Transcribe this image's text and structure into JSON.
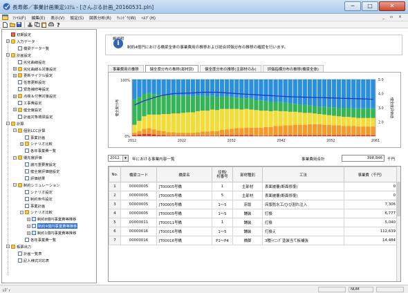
{
  "window": {
    "title": "長寿郎／事業計画策定ｼｽﾃﾑ - [さんぷる計画_20160531.pln]",
    "buttons": [
      "─",
      "□",
      "✕"
    ]
  },
  "menu": [
    "ﾌｧｲﾙ(F)",
    "編集(E)",
    "表示(V)",
    "設定(S)",
    "図表分析(R)",
    "ｳｨﾝﾄﾞｳ(W)",
    "ﾍﾙﾌﾟ(H)"
  ],
  "mdi_controls": "_ ▫ ×",
  "toolbar_icons": [
    "new-icon",
    "open-icon",
    "save-icon",
    "cut-icon",
    "copy-icon",
    "paste-icon",
    "print-icon",
    "help-icon"
  ],
  "tree": [
    {
      "label": "初期設定",
      "icon": "red",
      "expander": ""
    },
    {
      "label": "入力データ",
      "icon": "folder",
      "expander": "−"
    },
    {
      "label": "橋梁データ一覧",
      "icon": "doc",
      "expander": ""
    },
    {
      "label": "計画設定",
      "icon": "folder",
      "expander": "−"
    },
    {
      "label": "劣化曲線設定",
      "icon": "doc",
      "expander": ""
    },
    {
      "label": "劣化曲線＆対策設定",
      "icon": "folder",
      "expander": "+"
    },
    {
      "label": "更新サイクル設定",
      "icon": "folder",
      "expander": "+"
    },
    {
      "label": "任意更新設定",
      "icon": "doc",
      "expander": ""
    },
    {
      "label": "緊急補修等設定",
      "icon": "doc",
      "expander": ""
    },
    {
      "label": "点検＆付帯対策設定",
      "icon": "folder",
      "expander": "+"
    },
    {
      "label": "工事費設定",
      "icon": "doc",
      "expander": ""
    },
    {
      "label": "健全度設定",
      "icon": "folder",
      "expander": "+"
    },
    {
      "label": "計画対象橋梁設定",
      "icon": "doc",
      "expander": ""
    },
    {
      "label": "計算",
      "icon": "folder",
      "expander": "−"
    },
    {
      "label": "個別LCC計算",
      "icon": "folder",
      "expander": "−"
    },
    {
      "label": "事業計画",
      "icon": "doc",
      "expander": ""
    },
    {
      "label": "シナリオ比較",
      "icon": "folder",
      "expander": "+"
    },
    {
      "label": "各年事業費一覧",
      "icon": "doc",
      "expander": ""
    },
    {
      "label": "優先度評価",
      "icon": "folder",
      "expander": "−"
    },
    {
      "label": "諸元重要度設定",
      "icon": "doc",
      "expander": ""
    },
    {
      "label": "健全度評価値設定",
      "icon": "doc",
      "expander": ""
    },
    {
      "label": "評価結果",
      "icon": "doc",
      "expander": ""
    },
    {
      "label": "制約シミュレーション",
      "icon": "folder",
      "expander": "−"
    },
    {
      "label": "シナリオ設定",
      "icon": "doc",
      "expander": ""
    },
    {
      "label": "制約条件設定",
      "icon": "doc",
      "expander": ""
    },
    {
      "label": "事業計画",
      "icon": "doc",
      "expander": ""
    },
    {
      "label": "シナリオ比較",
      "icon": "folder",
      "expander": "−"
    },
    {
      "label": "制約8億円事業費等推移",
      "icon": "item",
      "expander": "+"
    },
    {
      "label": "制約4億円事業費等推移",
      "icon": "item",
      "expander": "+",
      "selected": true
    },
    {
      "label": "制約1億円事業費等推移",
      "icon": "item",
      "expander": "+"
    },
    {
      "label": "各年事業費一覧",
      "icon": "doc",
      "expander": ""
    },
    {
      "label": "帳票出力",
      "icon": "folder",
      "expander": "−"
    },
    {
      "label": "計画一覧表",
      "icon": "doc",
      "expander": ""
    },
    {
      "label": "記入様式対応表",
      "icon": "doc",
      "expander": ""
    }
  ],
  "explanation": {
    "title": "概説明",
    "text": "制約4億円における橋梁全体の事業費用の推移および総合評価分布の推移の確認を行います。"
  },
  "tabs": [
    "事業費用の推移",
    "健全度分布の推移(部材別)",
    "健全度分布の推移(主部材のみ)",
    "評価指標分布の推移(橋梁全体)"
  ],
  "active_tab": 1,
  "chart_data": {
    "type": "area",
    "title": "",
    "xlabel": "",
    "ylabel": "健全度分布",
    "y2label": "健全度評価値",
    "x_ticks": [
      "2012",
      "2022",
      "2032",
      "2042",
      "2052",
      "2061"
    ],
    "y_ticks": [
      "0%",
      "100%"
    ],
    "y2_ticks": [
      "2.0",
      "3.0",
      "4.0",
      "5.0"
    ],
    "xlim": [
      2012,
      2061
    ],
    "ylim": [
      0,
      100
    ],
    "y2lim": [
      1.0,
      5.0
    ],
    "stacked": true,
    "series": [
      {
        "color": "#d93b2b",
        "values": [
          2,
          3,
          4,
          4,
          3,
          2,
          2,
          1,
          1,
          1,
          1,
          1,
          1,
          1,
          1,
          1,
          1,
          1,
          2,
          2,
          2,
          2,
          2,
          2,
          2,
          1,
          1,
          1,
          1,
          2,
          2,
          2,
          2,
          2,
          2,
          2,
          2,
          2,
          2,
          2,
          2,
          2,
          2,
          2,
          2,
          2,
          2,
          2,
          2,
          2
        ]
      },
      {
        "color": "#f39a2a",
        "values": [
          4,
          6,
          9,
          10,
          9,
          8,
          7,
          6,
          6,
          5,
          5,
          5,
          5,
          6,
          7,
          7,
          8,
          8,
          9,
          10,
          11,
          12,
          12,
          13,
          13,
          14,
          14,
          15,
          15,
          16,
          16,
          17,
          17,
          18,
          18,
          18,
          19,
          19,
          19,
          18,
          18,
          17,
          17,
          16,
          16,
          16,
          15,
          15,
          15,
          15
        ]
      },
      {
        "color": "#f2dc3a",
        "values": [
          14,
          18,
          22,
          24,
          26,
          28,
          30,
          32,
          33,
          34,
          35,
          36,
          36,
          37,
          37,
          37,
          38,
          37,
          37,
          36,
          35,
          34,
          33,
          33,
          32,
          31,
          30,
          29,
          28,
          27,
          26,
          25,
          24,
          23,
          22,
          21,
          20,
          19,
          18,
          18,
          17,
          17,
          16,
          16,
          16,
          15,
          15,
          15,
          15,
          15
        ]
      },
      {
        "color": "#36b457",
        "values": [
          45,
          42,
          40,
          38,
          36,
          35,
          34,
          33,
          32,
          31,
          30,
          29,
          28,
          27,
          26,
          25,
          24,
          23,
          22,
          22,
          21,
          20,
          20,
          19,
          19,
          18,
          18,
          17,
          17,
          16,
          16,
          15,
          15,
          14,
          14,
          14,
          13,
          13,
          13,
          14,
          14,
          15,
          15,
          16,
          16,
          16,
          17,
          17,
          17,
          17
        ]
      },
      {
        "color": "#2b8fd9",
        "values": [
          35,
          31,
          25,
          24,
          26,
          27,
          27,
          28,
          28,
          29,
          29,
          29,
          30,
          29,
          29,
          30,
          29,
          31,
          30,
          30,
          31,
          32,
          33,
          33,
          34,
          36,
          37,
          38,
          39,
          39,
          40,
          41,
          42,
          43,
          44,
          45,
          46,
          47,
          48,
          48,
          49,
          49,
          50,
          50,
          50,
          51,
          51,
          51,
          51,
          51
        ]
      }
    ],
    "line": {
      "color": "#1b2bd0",
      "values": [
        3.2,
        3.35,
        3.5,
        3.6,
        3.72,
        3.82,
        3.9,
        3.95,
        4.0,
        4.02,
        4.03,
        4.04,
        4.05,
        4.08,
        4.1,
        4.1,
        4.1,
        4.1,
        4.08,
        4.05,
        4.03,
        4.0,
        3.98,
        3.96,
        3.94,
        3.92,
        3.9,
        3.88,
        3.86,
        3.84,
        3.82,
        3.8,
        3.78,
        3.77,
        3.76,
        3.75,
        3.74,
        3.73,
        3.72,
        3.71,
        3.7,
        3.69,
        3.68,
        3.67,
        3.66,
        3.65,
        3.64,
        3.63,
        3.62,
        3.6
      ]
    }
  },
  "year_select": {
    "value": "2012",
    "label": "年における事業内容一覧"
  },
  "total": {
    "label": "事業費用合計",
    "value": "398,846",
    "unit": "千円"
  },
  "table": {
    "headers": [
      "No.",
      "橋梁コード",
      "橋梁名",
      "径間/\n桁番号",
      "部材種別",
      "工法",
      "事業費（千円）"
    ],
    "rows": [
      [
        "1",
        "00000005",
        "JT00005号橋",
        "1",
        "主部材",
        "表面被覆(断面修復)",
        "0"
      ],
      [
        "2",
        "00000005",
        "JT00005号橋",
        "5",
        "主部材",
        "表面被覆(断面修復)",
        "0"
      ],
      [
        "3",
        "00000005",
        "JT00005号橋",
        "1〜5",
        "床版",
        "床版防水工/ひび割れ注入",
        "7,306"
      ],
      [
        "4",
        "00000005",
        "JT00005号橋",
        "1〜5",
        "舗装",
        "打換",
        "6,777"
      ],
      [
        "5",
        "00000011",
        "JT00011号橋",
        "1",
        "舗装",
        "打換",
        "5,040"
      ],
      [
        "6",
        "00000016",
        "JT00016号橋",
        "1〜5",
        "舗装",
        "打換え",
        "112,639"
      ],
      [
        "7",
        "00000016",
        "JT00016号橋",
        "P1〜P4",
        "橋脚",
        "3種ﾗｲﾆﾝｸﾞ塗装当て板補強",
        "14,484"
      ]
    ]
  },
  "status": {
    "text": "ﾚﾃﾞｨ",
    "num": "NUM"
  }
}
